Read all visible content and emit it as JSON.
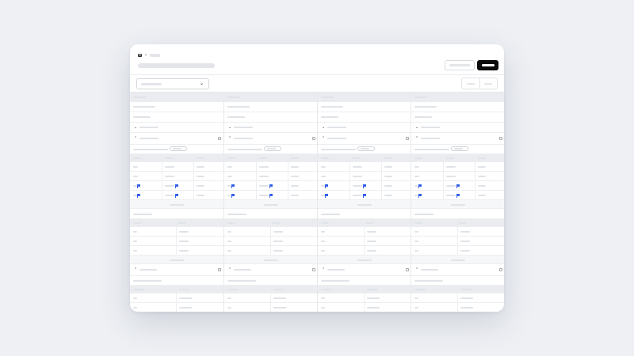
{
  "screen": {
    "background": "#eef0f4",
    "accent_primary": "#0b0b0b",
    "flag_color": "#2f5ee8"
  },
  "icons": {
    "home": "home-icon",
    "breadcrumb_separator": "chevron-right-icon",
    "dropdown": "chevron-down-icon",
    "expand": "chevron-up-icon",
    "collapse": "chevron-down-icon",
    "flag": "flag-icon",
    "more": "square-icon"
  },
  "breadcrumb": {
    "separator": "›"
  },
  "dropdown": {
    "chevron": "⌄"
  },
  "columns_count": 4
}
